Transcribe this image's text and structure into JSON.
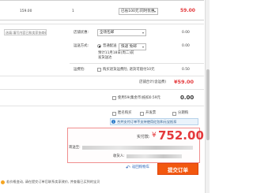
{
  "item": {
    "unit_price": "159.00",
    "quantity": "1",
    "promo_select": "已省100元:同时优惠",
    "subtotal": "59.00"
  },
  "message": {
    "placeholder": "选填:填写内容已和卖家协商确认"
  },
  "store_coupon": {
    "label": "店铺优惠:",
    "value": "全场包邮",
    "amount": "0.00"
  },
  "shipping": {
    "label": "运送方式:",
    "option_name": "普通配送",
    "method": "快递 免邮",
    "note_line1": "预计11月18日(周二)前",
    "note_line2": "发货送达",
    "amount": "0.00"
  },
  "insurance": {
    "label": "运费险:",
    "text": "购买退货运费险, 退货可赔付10元",
    "amount": "0.50"
  },
  "store_total": {
    "label": "店铺合计(含运费)",
    "amount": "¥59.00"
  },
  "points": {
    "text": "使用59(集金币)抵扣0.59元",
    "amount": "0.00"
  },
  "options": {
    "anonymous": "匿名购买",
    "invoice": "开发票",
    "installment": "分期购"
  },
  "notice": {
    "text": "合并支付订单不支持使用红包和元宝抵扣"
  },
  "summary": {
    "label": "实付款:",
    "amount": "752.00",
    "currency": "¥",
    "address_label": "寄送至:",
    "receiver_label": "收货人:"
  },
  "footer": {
    "back_link": "返回购物车",
    "submit_label": "提交订单",
    "bottom_notice": "若价格变动, 请在提交订单后联系卖家改价, 并查看已买到的宝贝"
  }
}
